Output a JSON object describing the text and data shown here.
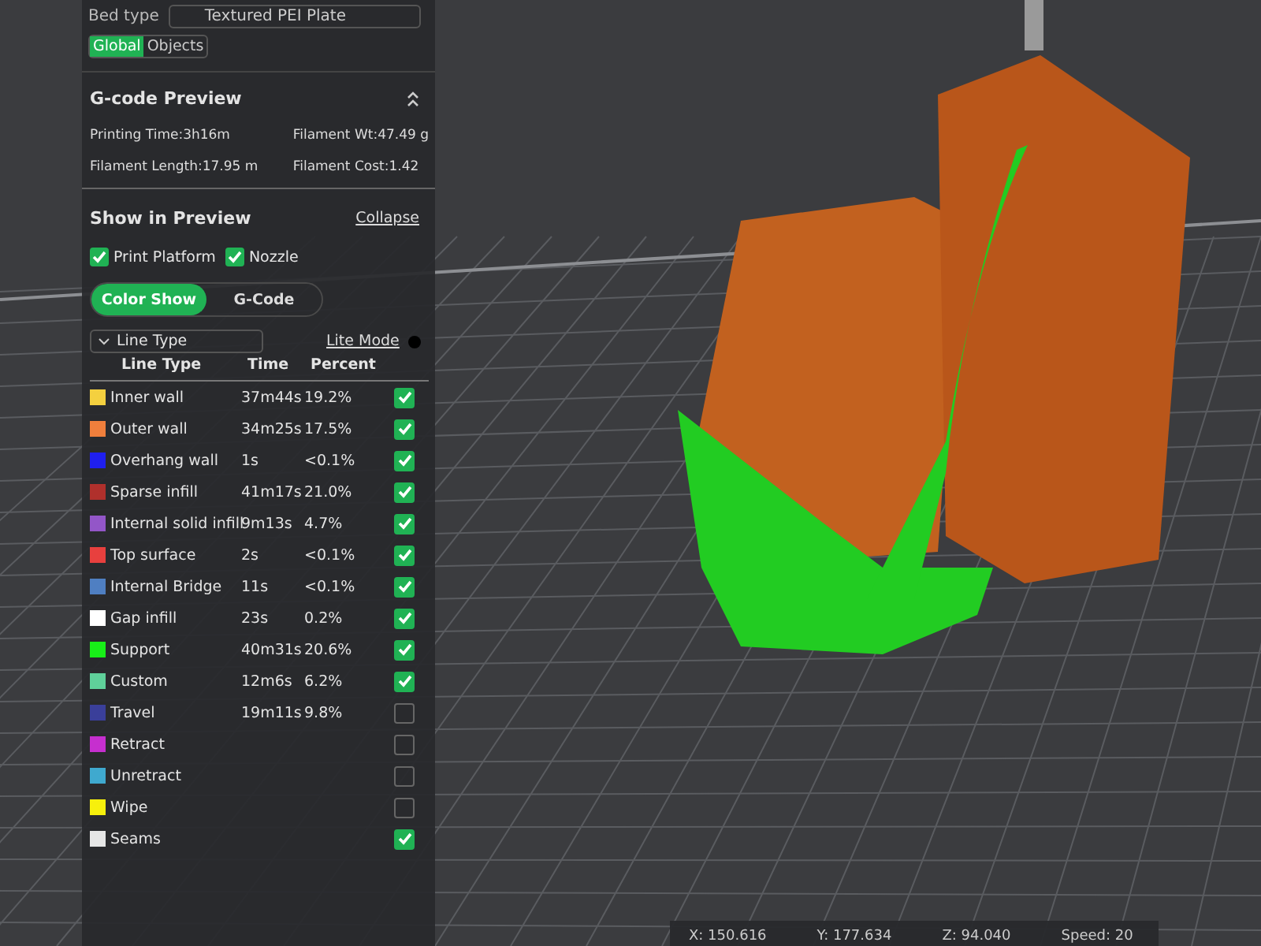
{
  "bed_type": {
    "label": "Bed type",
    "value": "Textured PEI Plate"
  },
  "scope_tabs": [
    {
      "label": "Global",
      "selected": true
    },
    {
      "label": "Objects",
      "selected": false
    }
  ],
  "gcode_preview": {
    "title": "G-code Preview",
    "printing_time": "Printing Time:3h16m",
    "filament_weight": "Filament Wt:47.49 g",
    "filament_length": "Filament Length:17.95 m",
    "filament_cost": "Filament Cost:1.42"
  },
  "show_in_preview": {
    "title": "Show in Preview",
    "collapse": "Collapse",
    "options": [
      {
        "label": "Print Platform",
        "checked": true
      },
      {
        "label": "Nozzle",
        "checked": true
      }
    ]
  },
  "view_tabs": [
    {
      "label": "Color Show",
      "selected": true
    },
    {
      "label": "G-Code",
      "selected": false
    }
  ],
  "line_type_select": "Line Type",
  "lite_mode": "Lite Mode",
  "table": {
    "columns": [
      "Line Type",
      "Time",
      "Percent"
    ],
    "rows": [
      {
        "name": "Inner wall",
        "time": "37m44s",
        "percent": "19.2%",
        "color": "#f4d03f",
        "checked": true
      },
      {
        "name": "Outer wall",
        "time": "34m25s",
        "percent": "17.5%",
        "color": "#f07f3c",
        "checked": true
      },
      {
        "name": "Overhang wall",
        "time": "1s",
        "percent": "<0.1%",
        "color": "#1f1fef",
        "checked": true
      },
      {
        "name": "Sparse infill",
        "time": "41m17s",
        "percent": "21.0%",
        "color": "#b0302c",
        "checked": true
      },
      {
        "name": "Internal solid infill",
        "time": "9m13s",
        "percent": "4.7%",
        "color": "#9356c8",
        "checked": true
      },
      {
        "name": "Top surface",
        "time": "2s",
        "percent": "<0.1%",
        "color": "#e8403e",
        "checked": true
      },
      {
        "name": "Internal Bridge",
        "time": "11s",
        "percent": "<0.1%",
        "color": "#4f7fc2",
        "checked": true
      },
      {
        "name": "Gap infill",
        "time": "23s",
        "percent": "0.2%",
        "color": "#ffffff",
        "checked": true
      },
      {
        "name": "Support",
        "time": "40m31s",
        "percent": "20.6%",
        "color": "#18ef18",
        "checked": true
      },
      {
        "name": "Custom",
        "time": "12m6s",
        "percent": "6.2%",
        "color": "#5fd09a",
        "checked": true
      },
      {
        "name": "Travel",
        "time": "19m11s",
        "percent": "9.8%",
        "color": "#3a3f9a",
        "checked": false
      },
      {
        "name": "Retract",
        "color": "#c62fcf",
        "checked": false
      },
      {
        "name": "Unretract",
        "color": "#3fa9cf",
        "checked": false
      },
      {
        "name": "Wipe",
        "color": "#f7f00c",
        "checked": false
      },
      {
        "name": "Seams",
        "color": "#e6e6e6",
        "checked": true
      }
    ]
  },
  "status_bar": [
    "X: 150.616",
    "Y: 177.634",
    "Z: 94.040",
    "Speed: 20"
  ]
}
